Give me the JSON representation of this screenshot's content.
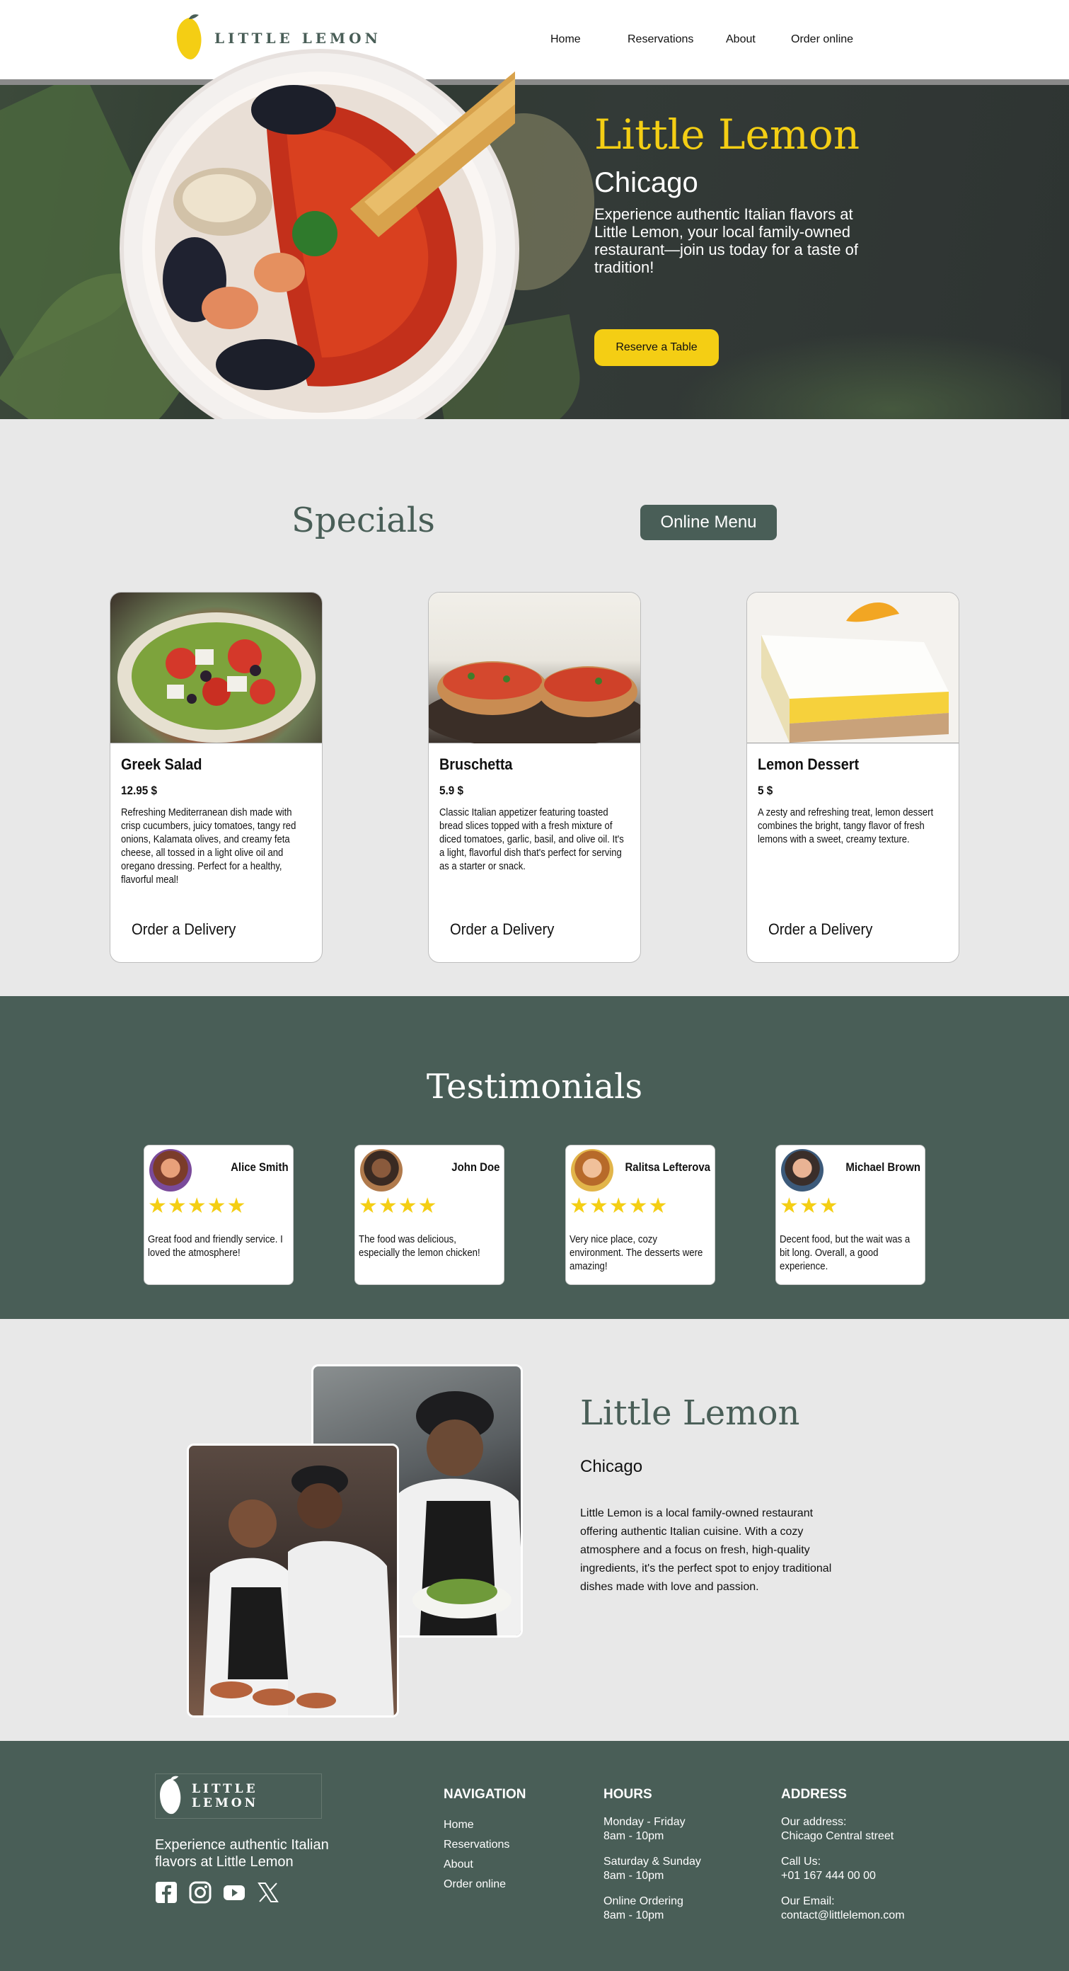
{
  "header": {
    "logo_text": "LITTLE LEMON",
    "nav": [
      "Home",
      "Reservations",
      "About",
      "Order online"
    ]
  },
  "hero": {
    "title": "Little Lemon",
    "subtitle": "Chicago",
    "text": "Experience authentic Italian flavors at Little Lemon, your local family-owned restaurant—join us today for a taste of tradition!",
    "button": "Reserve a Table"
  },
  "specials": {
    "title": "Specials",
    "menu_button": "Online Menu",
    "cards": [
      {
        "name": "Greek Salad",
        "price": "12.95 $",
        "description": "Refreshing Mediterranean dish made with crisp cucumbers, juicy tomatoes, tangy red onions, Kalamata olives, and creamy feta cheese, all tossed in a light olive oil and oregano dressing. Perfect for a healthy, flavorful meal!",
        "order": "Order a Delivery"
      },
      {
        "name": "Bruschetta",
        "price": "5.9 $",
        "description": "Classic Italian appetizer featuring toasted bread slices topped with a fresh mixture of diced tomatoes, garlic, basil, and olive oil. It's a light, flavorful dish that's perfect for serving as a starter or snack.",
        "order": "Order a Delivery"
      },
      {
        "name": "Lemon Dessert",
        "price": "5 $",
        "description": "A zesty and refreshing treat, lemon dessert combines the bright, tangy flavor of fresh lemons with a sweet, creamy texture.",
        "order": "Order a Delivery"
      }
    ]
  },
  "testimonials": {
    "title": "Testimonials",
    "items": [
      {
        "name": "Alice Smith",
        "stars": "★★★★★",
        "rating": 5,
        "text": "Great food and friendly service. I loved the atmosphere!"
      },
      {
        "name": "John Doe",
        "stars": "★★★★",
        "rating": 4,
        "text": "The food was delicious, especially the lemon chicken!"
      },
      {
        "name": "Ralitsa Lefterova",
        "stars": "★★★★★",
        "rating": 5,
        "text": "Very nice place, cozy environment. The desserts were amazing!"
      },
      {
        "name": "Michael Brown",
        "stars": "★★★",
        "rating": 3,
        "text": "Decent food, but the wait was a bit long. Overall, a good experience."
      }
    ]
  },
  "about": {
    "title": "Little Lemon",
    "subtitle": "Chicago",
    "text": "Little Lemon is a local family-owned restaurant offering authentic Italian cuisine. With a cozy atmosphere and a focus on fresh, high-quality ingredients, it's the perfect spot to enjoy traditional dishes made with love and passion."
  },
  "footer": {
    "logo_text": "LITTLE LEMON",
    "tagline": "Experience authentic Italian flavors at Little Lemon",
    "social_icons": [
      "facebook-icon",
      "instagram-icon",
      "youtube-icon",
      "x-icon"
    ],
    "navigation": {
      "heading": "NAVIGATION",
      "links": [
        "Home",
        "Reservations",
        "About",
        "Order online"
      ]
    },
    "hours": {
      "heading": "HOURS",
      "groups": [
        [
          "Monday - Friday",
          "8am - 10pm"
        ],
        [
          "Saturday & Sunday",
          "8am - 10pm"
        ],
        [
          "Online Ordering",
          "8am - 10pm"
        ]
      ]
    },
    "address": {
      "heading": "ADDRESS",
      "groups": [
        [
          "Our address:",
          "Chicago Central street"
        ],
        [
          "Call Us:",
          "+01 167 444 00 00"
        ],
        [
          "Our Email:",
          "contact@littlelemon.com"
        ]
      ]
    }
  },
  "colors": {
    "brand_green": "#495e57",
    "brand_yellow": "#f4ce14",
    "section_gray": "#e8e8e8"
  }
}
